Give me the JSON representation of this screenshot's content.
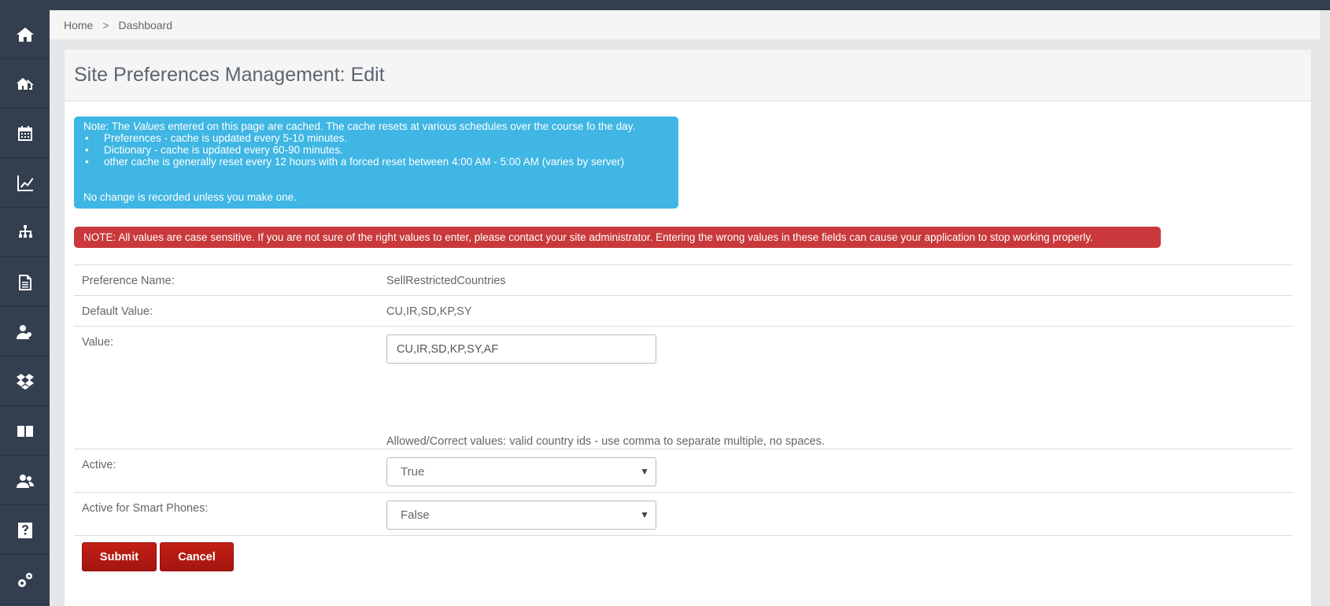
{
  "breadcrumb": {
    "home": "Home",
    "separator": ">",
    "current": "Dashboard"
  },
  "sidebar": {
    "items": [
      {
        "icon": "home-icon"
      },
      {
        "icon": "properties-icon"
      },
      {
        "icon": "calendar-icon"
      },
      {
        "icon": "chart-icon"
      },
      {
        "icon": "org-chart-icon"
      },
      {
        "icon": "document-icon"
      },
      {
        "icon": "users-icon"
      },
      {
        "icon": "dropbox-icon"
      },
      {
        "icon": "book-icon"
      },
      {
        "icon": "contacts-icon"
      },
      {
        "icon": "help-icon"
      },
      {
        "icon": "settings-icon"
      }
    ]
  },
  "page": {
    "title": "Site Preferences Management: Edit"
  },
  "info": {
    "prefix": "Note: The ",
    "emphasis": "Values",
    "suffix": " entered on this page are cached. The cache resets at various schedules over the course fo the day.",
    "items": [
      "Preferences - cache is updated every 5-10 minutes.",
      "Dictionary - cache is updated every 60-90 minutes.",
      "other cache is generally reset every 12 hours with a forced reset between 4:00 AM - 5:00 AM (varies by server)"
    ],
    "footer": "No change is recorded unless you make one."
  },
  "warning": "NOTE: All values are case sensitive. If you are not sure of the right values to enter, please contact your site administrator. Entering the wrong values in these fields can cause your application to stop working properly.",
  "form": {
    "preference_name_label": "Preference Name:",
    "preference_name": "SellRestrictedCountries",
    "default_value_label": "Default Value:",
    "default_value": "CU,IR,SD,KP,SY",
    "value_label": "Value:",
    "value": "CU,IR,SD,KP,SY,AF",
    "hint": "Allowed/Correct values: valid country ids - use comma to separate multiple, no spaces.",
    "active_label": "Active:",
    "active_value": "True",
    "smart_label": "Active for Smart Phones:",
    "smart_value": "False"
  },
  "buttons": {
    "submit": "Submit",
    "cancel": "Cancel"
  },
  "colors": {
    "sidebar": "#333f4f",
    "info": "#3fb6e4",
    "warning": "#c9393b",
    "button": "#b01a12"
  }
}
